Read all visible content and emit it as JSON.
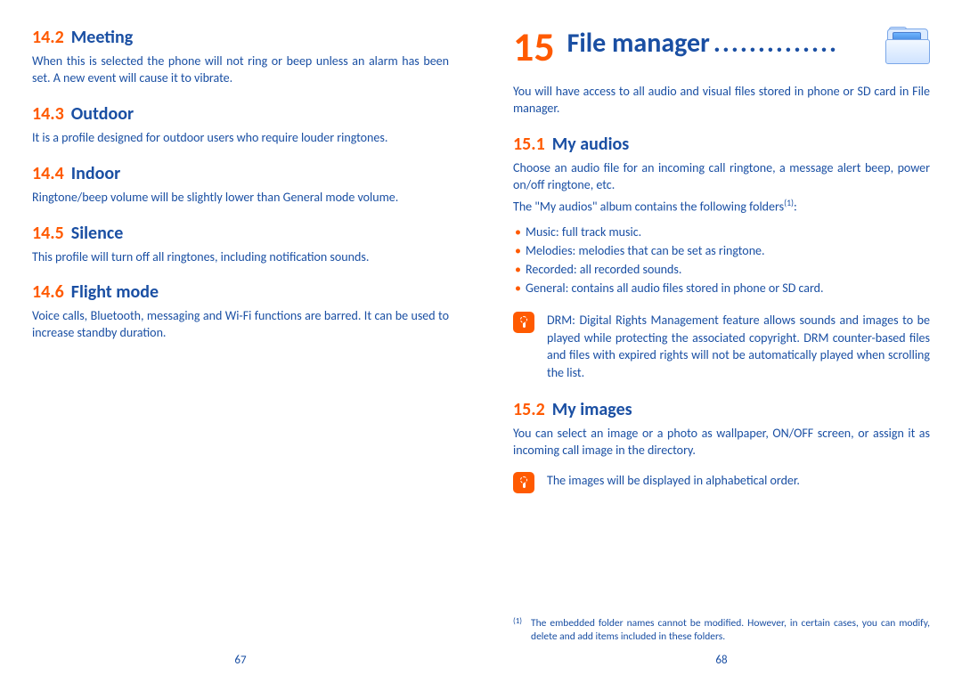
{
  "left": {
    "sections": [
      {
        "num": "14.2",
        "title": "Meeting",
        "body": "When this is selected the phone will not ring or beep unless an alarm has been set. A new event will cause it to vibrate."
      },
      {
        "num": "14.3",
        "title": "Outdoor",
        "body": "It is a profile designed for outdoor users who require louder ringtones."
      },
      {
        "num": "14.4",
        "title": "Indoor",
        "body": "Ringtone/beep volume will be slightly lower than General mode volume."
      },
      {
        "num": "14.5",
        "title": "Silence",
        "body": "This profile will turn off all ringtones, including notification sounds."
      },
      {
        "num": "14.6",
        "title": "Flight mode",
        "body": "Voice calls, Bluetooth, messaging and Wi-Fi functions are barred. It can be used to increase standby duration."
      }
    ],
    "page_num": "67"
  },
  "right": {
    "chapter_num": "15",
    "chapter_title": "File manager",
    "chapter_dots": "..............",
    "intro": "You will have access to all audio and visual files stored in phone or SD card in File manager.",
    "s151": {
      "num": "15.1",
      "title": "My audios",
      "p1": "Choose an audio file for an incoming call ringtone, a message alert beep, power on/off ringtone, etc.",
      "p2_pre": "The \"My audios\" album contains the following folders",
      "p2_sup": "(1)",
      "p2_post": ":",
      "bullets": [
        "Music: full track music.",
        "Melodies: melodies that can be set as ringtone.",
        "Recorded: all recorded sounds.",
        "General: contains all audio files stored in phone or SD card."
      ],
      "tip": "DRM: Digital Rights Management feature allows sounds and images to be played while protecting the associated copyright. DRM counter-based files and files with expired rights will not be automatically played when scrolling the list."
    },
    "s152": {
      "num": "15.2",
      "title": "My images",
      "p1": "You can select an image or a photo as wallpaper, ON/OFF screen, or assign it as incoming call image in the directory.",
      "tip": "The images will be displayed in alphabetical order."
    },
    "footnote_mark": "(1)",
    "footnote": "The embedded folder names cannot be modified. However, in certain cases, you can modify, delete and add items included in these folders.",
    "page_num": "68"
  }
}
